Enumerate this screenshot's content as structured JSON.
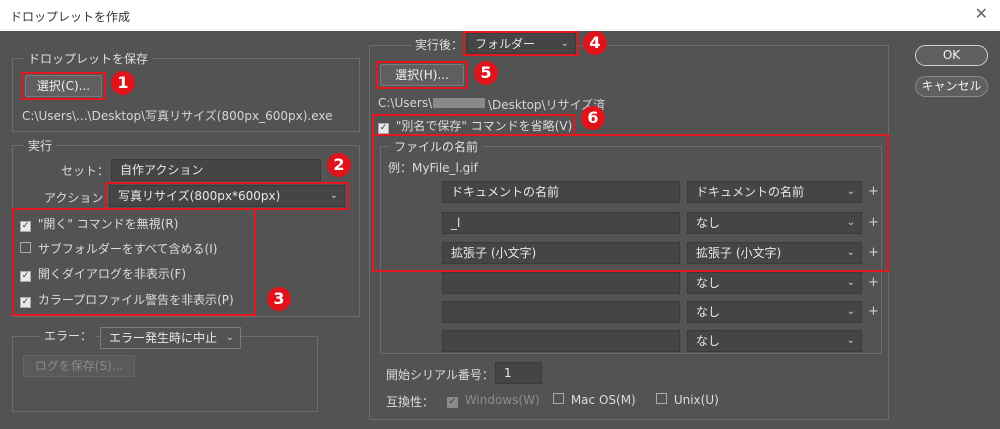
{
  "window": {
    "title": "ドロップレットを作成",
    "close_glyph": "✕"
  },
  "save_group": {
    "legend": "ドロップレットを保存",
    "choose_label": "選択(C)...",
    "path": "C:\\Users\\...\\Desktop\\写真リサイズ(800px_600px).exe"
  },
  "run_group": {
    "legend": "実行",
    "set_label": "セット：",
    "set_value": "自作アクション",
    "action_label": "アクション：",
    "action_value": "写真リサイズ(800px*600px)",
    "options": [
      {
        "label": "\"開く\" コマンドを無視(R)",
        "checked": true
      },
      {
        "label": "サブフォルダーをすべて含める(I)",
        "checked": false
      },
      {
        "label": "開くダイアログを非表示(F)",
        "checked": true
      },
      {
        "label": "カラープロファイル警告を非表示(P)",
        "checked": true
      }
    ]
  },
  "error_group": {
    "label": "エラー：",
    "value": "エラー発生時に中止",
    "save_log_label": "ログを保存(S)..."
  },
  "after_group": {
    "label": "実行後：",
    "value": "フォルダー",
    "choose_label": "選択(H)...",
    "path_left": "C:\\Users\\",
    "path_right": "\\Desktop\\リサイズ済",
    "override_label": "\"別名で保存\" コマンドを省略(V)",
    "override_checked": true
  },
  "naming_group": {
    "legend": "ファイルの名前",
    "example": "例：MyFile_l.gif",
    "rows": [
      {
        "text": "ドキュメントの名前",
        "option": "ドキュメントの名前",
        "plus": "+"
      },
      {
        "text": "_l",
        "option": "なし",
        "plus": "+"
      },
      {
        "text": "拡張子 (小文字)",
        "option": "拡張子 (小文字)",
        "plus": "+"
      },
      {
        "text": "",
        "option": "なし",
        "plus": "+"
      },
      {
        "text": "",
        "option": "なし",
        "plus": "+"
      },
      {
        "text": "",
        "option": "なし",
        "plus": ""
      }
    ],
    "serial_label": "開始シリアル番号：",
    "serial_value": "1",
    "compat_label": "互換性：",
    "compat": [
      {
        "label": "Windows(W)",
        "checked": true,
        "disabled": true
      },
      {
        "label": "Mac OS(M)",
        "checked": false,
        "disabled": false
      },
      {
        "label": "Unix(U)",
        "checked": false,
        "disabled": false
      }
    ]
  },
  "buttons": {
    "ok": "OK",
    "cancel": "キャンセル"
  },
  "badges": [
    "1",
    "2",
    "3",
    "4",
    "5",
    "6"
  ],
  "colors": {
    "highlight": "#e5171f",
    "dialog_bg": "#535353"
  }
}
